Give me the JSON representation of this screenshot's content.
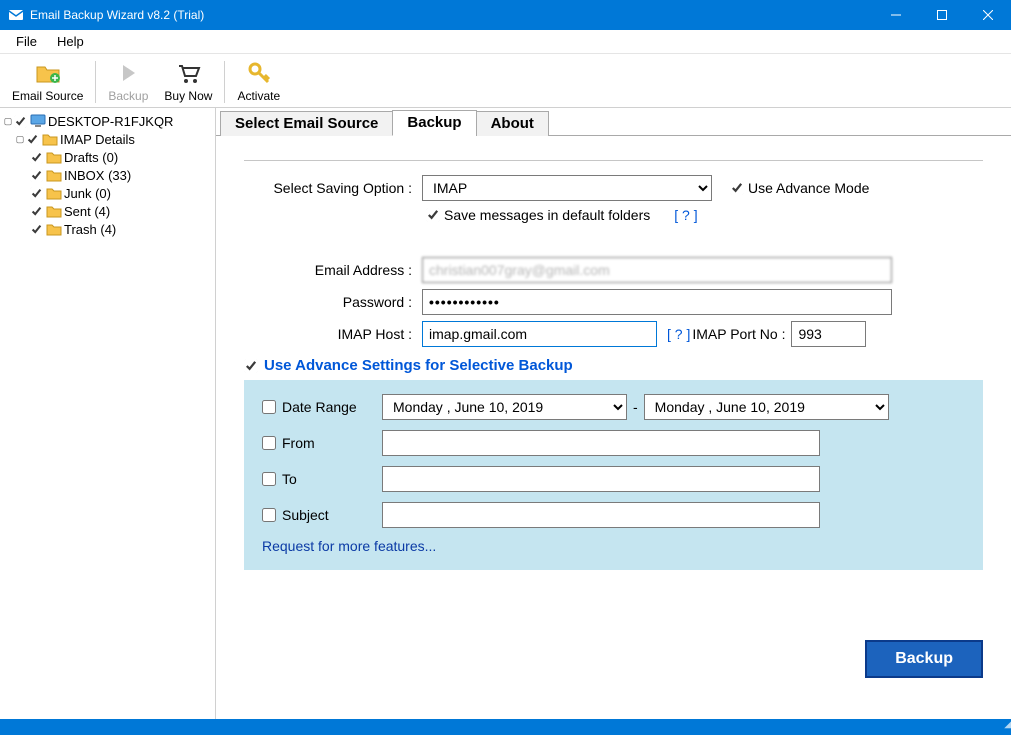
{
  "window": {
    "title": "Email Backup Wizard v8.2 (Trial)"
  },
  "menu": {
    "file": "File",
    "help": "Help"
  },
  "toolbar": {
    "email_source": "Email Source",
    "backup": "Backup",
    "buy_now": "Buy Now",
    "activate": "Activate"
  },
  "tree": {
    "root": "DESKTOP-R1FJKQR",
    "imap_details": "IMAP Details",
    "folders": [
      {
        "label": "Drafts (0)"
      },
      {
        "label": "INBOX (33)"
      },
      {
        "label": "Junk (0)"
      },
      {
        "label": "Sent (4)"
      },
      {
        "label": "Trash (4)"
      }
    ]
  },
  "tabs": {
    "select_source": "Select Email Source",
    "backup": "Backup",
    "about": "About"
  },
  "backup": {
    "saving_option_label": "Select Saving Option :",
    "saving_option_value": "IMAP",
    "use_advance_mode": "Use Advance Mode",
    "save_default": "Save messages in default folders",
    "help": "[ ? ]",
    "email_label": "Email Address :",
    "email_value": "christian007gray@gmail.com",
    "password_label": "Password :",
    "password_value": "••••••••••••",
    "imap_host_label": "IMAP Host :",
    "imap_host_value": "imap.gmail.com",
    "imap_port_label": "IMAP Port No :",
    "imap_port_value": "993",
    "advance_title": "Use Advance Settings for Selective Backup",
    "date_range": "Date Range",
    "date_from": "Monday   ,      June     10, 2019",
    "date_sep": "-",
    "date_to": "Monday   ,      June     10, 2019",
    "from_lbl": "From",
    "to_lbl": "To",
    "subject_lbl": "Subject",
    "request_link": "Request for more features...",
    "from_val": "",
    "to_val": "",
    "subject_val": ""
  },
  "buttons": {
    "backup": "Backup"
  }
}
